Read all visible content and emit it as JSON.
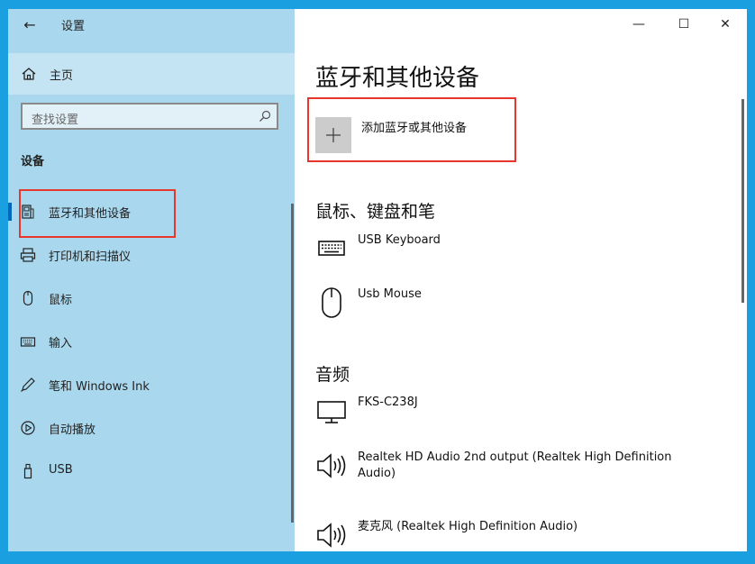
{
  "app": {
    "title": "设置"
  },
  "sidebar": {
    "home_label": "主页",
    "search_placeholder": "查找设置",
    "section_title": "设备",
    "items": [
      {
        "label": "蓝牙和其他设备",
        "icon": "bluetooth-devices-icon",
        "selected": true
      },
      {
        "label": "打印机和扫描仪",
        "icon": "printer-icon"
      },
      {
        "label": "鼠标",
        "icon": "mouse-icon"
      },
      {
        "label": "输入",
        "icon": "keyboard-icon"
      },
      {
        "label": "笔和 Windows Ink",
        "icon": "pen-icon"
      },
      {
        "label": "自动播放",
        "icon": "autoplay-icon"
      },
      {
        "label": "USB",
        "icon": "usb-icon"
      }
    ]
  },
  "window_controls": {
    "minimize": "—",
    "maximize": "☐",
    "close": "✕"
  },
  "main": {
    "title": "蓝牙和其他设备",
    "add_device_label": "添加蓝牙或其他设备",
    "groups": [
      {
        "title": "鼠标、键盘和笔",
        "devices": [
          {
            "name": "USB Keyboard",
            "icon": "keyboard-icon"
          },
          {
            "name": "Usb Mouse",
            "icon": "mouse-icon"
          }
        ]
      },
      {
        "title": "音频",
        "devices": [
          {
            "name": "FKS-C238J",
            "icon": "monitor-icon"
          },
          {
            "name": "Realtek HD Audio 2nd output (Realtek High Definition Audio)",
            "icon": "speaker-icon"
          },
          {
            "name": "麦克风 (Realtek High Definition Audio)",
            "icon": "speaker-icon"
          }
        ]
      }
    ]
  },
  "colors": {
    "accent": "#0067c0",
    "sidebar_bg": "#a9d8ee",
    "highlight": "#e8362b",
    "desktop": "#1aa0e0"
  }
}
